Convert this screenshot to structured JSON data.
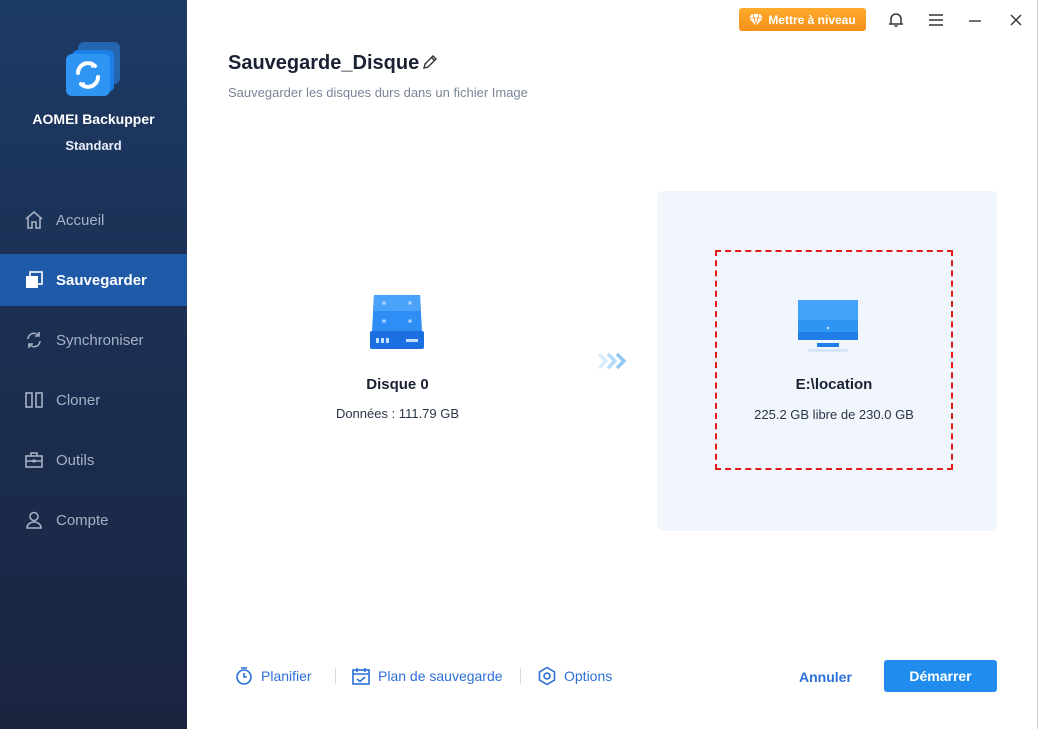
{
  "app": {
    "name": "AOMEI Backupper",
    "edition": "Standard",
    "upgrade_label": "Mettre à niveau"
  },
  "sidebar": {
    "items": [
      {
        "label": "Accueil",
        "icon": "home-icon",
        "active": false
      },
      {
        "label": "Sauvegarder",
        "icon": "backup-icon",
        "active": true
      },
      {
        "label": "Synchroniser",
        "icon": "sync-icon",
        "active": false
      },
      {
        "label": "Cloner",
        "icon": "clone-icon",
        "active": false
      },
      {
        "label": "Outils",
        "icon": "toolbox-icon",
        "active": false
      },
      {
        "label": "Compte",
        "icon": "user-icon",
        "active": false
      }
    ]
  },
  "header": {
    "title": "Sauvegarde_Disque",
    "subtitle": "Sauvegarder les disques durs dans un fichier Image"
  },
  "source": {
    "name": "Disque 0",
    "info": "Données : 111.79 GB"
  },
  "destination": {
    "name": "E:\\location",
    "info": "225.2 GB libre de 230.0 GB"
  },
  "footer": {
    "schedule_label": "Planifier",
    "scheme_label": "Plan de sauvegarde",
    "options_label": "Options",
    "cancel_label": "Annuler",
    "start_label": "Démarrer"
  },
  "colors": {
    "sidebar_bg": "#1b2c4d",
    "active_nav": "#1e5aa8",
    "accent": "#1f8cee",
    "upgrade": "#f59018",
    "highlight_border": "#e21a1a"
  }
}
